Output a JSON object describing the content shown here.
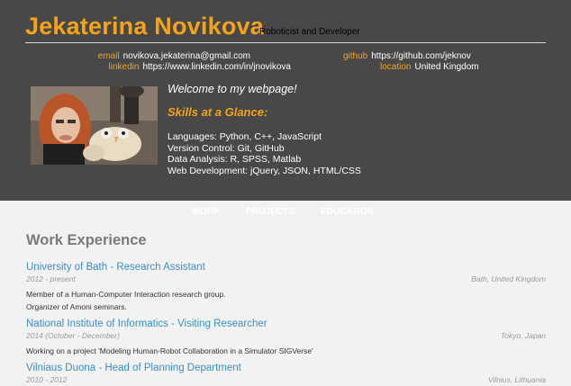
{
  "header": {
    "name": "Jekaterina Novikova",
    "tagline": "Roboticist and Developer",
    "contacts": {
      "email_label": "email",
      "email_value": "novikova.jekaterina@gmail.com",
      "linkedin_label": "linkedin",
      "linkedin_value": "https://www.linkedin.com/in/jnovikova",
      "github_label": "github",
      "github_value": "https://github.com/jeknov",
      "location_label": "location",
      "location_value": "United Kingdom"
    },
    "welcome": "Welcome to my webpage!",
    "skills_title": "Skills at a Glance:",
    "skills": [
      "Languages: Python, C++, JavaScript",
      "Version Control: Git, GitHub",
      "Data Analysis: R, SPSS, Matlab",
      "Web Development: jQuery, JSON, HTML/CSS"
    ]
  },
  "nav": [
    "WORK",
    "PROJECTS",
    "EDUCATION"
  ],
  "work": {
    "title": "Work Experience",
    "jobs": [
      {
        "title": "University of Bath - Research Assistant",
        "dates": "2012 - present",
        "location": "Bath, United Kingdom",
        "desc": [
          "Member of a Human-Computer Interaction research group.",
          "Organizer of Amoni seminars."
        ]
      },
      {
        "title": "National Institute of Informatics - Visiting Researcher",
        "dates": "2014 (October - December)",
        "location": "Tokyo, Japan",
        "desc": [
          "Working on a project 'Modeling Human-Robot Collaboration in a Simulator SIGVerse'"
        ]
      },
      {
        "title": "Vilniaus Duona - Head of Planning Department",
        "dates": "2010 - 2012",
        "location": "Vilnius, Lithuania",
        "desc": []
      }
    ]
  },
  "colors": {
    "accent": "#f5a31b",
    "link": "#3b8fc6",
    "header_bg": "#484848",
    "page_bg": "#f2f2f2"
  },
  "icons": {
    "photo": "profile-photo"
  }
}
